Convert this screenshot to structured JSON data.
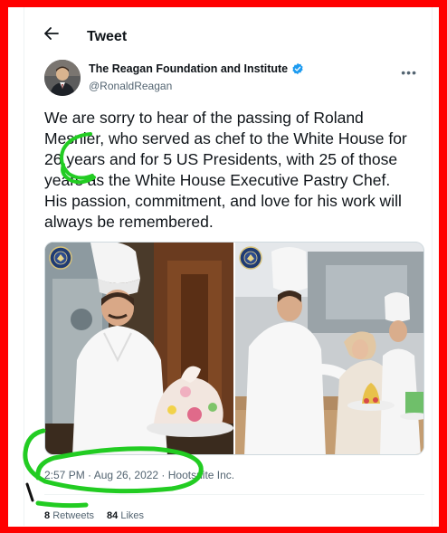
{
  "header": {
    "title": "Tweet",
    "back_icon": "arrow-left-icon"
  },
  "author": {
    "name": "The Reagan Foundation and Institute",
    "handle": "@RonaldReagan",
    "verified_icon": "verified-badge-icon",
    "more_icon": "more-icon",
    "more_label": "•••"
  },
  "tweet": {
    "text": "We are sorry to hear of the passing of Roland Mesnier, who served as chef to the White House for 26 years and for 5 US Presidents, with 25 of those years as the White House Executive Pastry Chef. His passion, commitment, and love for his work will always be remembered."
  },
  "media": {
    "photos": [
      {
        "description_icon": "photo-chef-with-cake"
      },
      {
        "description_icon": "photo-kitchen-with-chefs"
      }
    ]
  },
  "meta": {
    "timestamp": "2:57 PM · Aug 26, 2022 · Hootsuite Inc."
  },
  "stats": {
    "retweets_count": "8",
    "retweets_label": "Retweets",
    "likes_count": "84",
    "likes_label": "Likes"
  },
  "colors": {
    "frame": "#ff0000",
    "annotation": "#22cc22",
    "verified": "#1d9bf0",
    "muted": "#536471"
  }
}
